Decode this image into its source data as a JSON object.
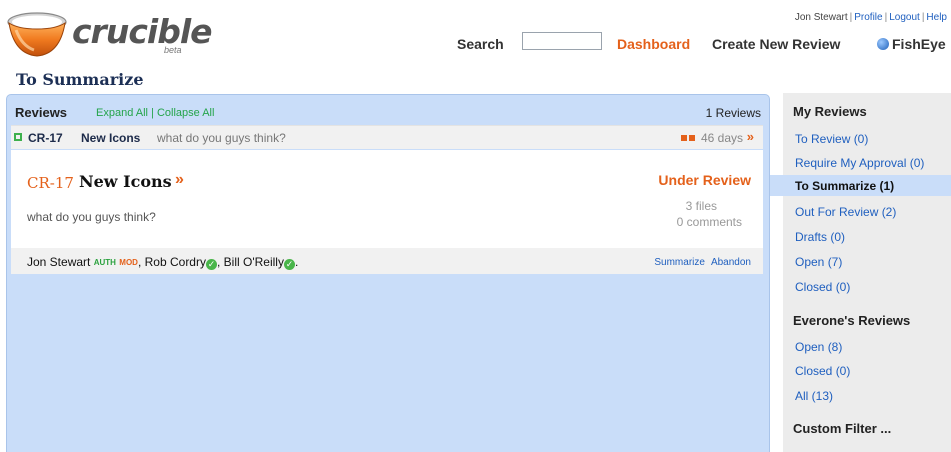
{
  "brand": {
    "name": "crucible",
    "tag": "beta"
  },
  "header": {
    "user": "Jon Stewart",
    "links": [
      "Profile",
      "Logout",
      "Help"
    ],
    "search_label": "Search",
    "search_value": "",
    "nav": [
      "Dashboard",
      "Create New Review",
      "FishEye"
    ]
  },
  "page_title": "To Summarize",
  "reviews_panel": {
    "heading": "Reviews",
    "expand_all": "Expand All",
    "collapse_all": "Collapse All",
    "count": "1 Reviews",
    "review": {
      "id": "CR-17",
      "title": "New Icons",
      "description": "what do you guys think?",
      "age": "46 days",
      "status": "Under Review",
      "files": "3 files",
      "comments": "0 comments",
      "participants": [
        {
          "name": "Jon Stewart",
          "roles": [
            "AUTH",
            "MOD"
          ]
        },
        {
          "name": "Rob Cordry",
          "completed": true
        },
        {
          "name": "Bill O'Reilly",
          "completed": true
        }
      ],
      "actions": [
        "Summarize",
        "Abandon"
      ]
    }
  },
  "sidebar": {
    "my_reviews_heading": "My Reviews",
    "my_reviews": [
      "To Review (0)",
      "Require My Approval (0)",
      "To Summarize (1)",
      "Out For Review (2)",
      "Drafts (0)",
      "Open (7)",
      "Closed (0)"
    ],
    "active_index": 2,
    "everyone_heading": "Everone's Reviews",
    "everyone": [
      "Open (8)",
      "Closed (0)",
      "All (13)"
    ],
    "custom_filter": "Custom Filter ..."
  },
  "colors": {
    "accent": "#e4611b",
    "link": "#1f5fbf",
    "panel": "#c9ddf9",
    "green": "#49b54a"
  }
}
